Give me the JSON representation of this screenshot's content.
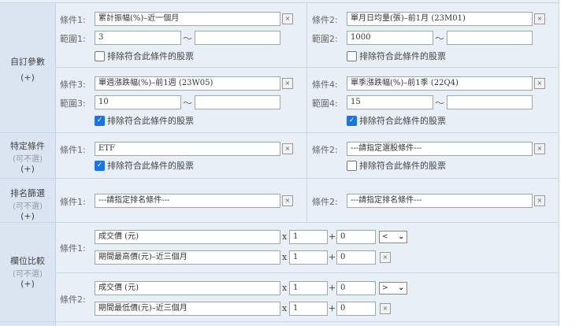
{
  "sections": {
    "custom": {
      "title": "自訂參數",
      "plus": "(+)"
    },
    "specific": {
      "title": "特定條件",
      "optional": "(可不選)",
      "plus": "(+)"
    },
    "rank": {
      "title": "排名篩選",
      "optional": "(可不選)",
      "plus": "(+)"
    },
    "compare": {
      "title": "欄位比較",
      "optional": "(可不選)",
      "plus": "(+)"
    }
  },
  "exclude_label": "排除符合此條件的股票",
  "remove": "×",
  "tilde": "～",
  "custom": [
    {
      "label": "條件1:",
      "value": "累計振幅(%)–近一個月",
      "range_label": "範圍1:",
      "min": "3",
      "max": "",
      "exclude": false
    },
    {
      "label": "條件2:",
      "value": "單月日均量(張)–前1月 (23M01)",
      "range_label": "範圍2:",
      "min": "1000",
      "max": "",
      "exclude": false
    },
    {
      "label": "條件3:",
      "value": "單週漲跌幅(%)–前1週 (23W05)",
      "range_label": "範圍3:",
      "min": "10",
      "max": "",
      "exclude": true
    },
    {
      "label": "條件4:",
      "value": "單季漲跌幅(%)–前1季 (22Q4)",
      "range_label": "範圍4:",
      "min": "15",
      "max": "",
      "exclude": true
    }
  ],
  "specific": [
    {
      "label": "條件1:",
      "value": "ETF",
      "exclude": true
    },
    {
      "label": "條件2:",
      "value": "---請指定選股條件---",
      "exclude": false
    }
  ],
  "rank": [
    {
      "label": "條件1:",
      "value": "---請指定排名條件---"
    },
    {
      "label": "條件2:",
      "value": "---請指定排名條件---"
    }
  ],
  "compare": [
    {
      "label": "條件1:",
      "operator": "<",
      "a": {
        "field": "成交價 (元)",
        "mult": "1",
        "add": "0"
      },
      "b": {
        "field": "期間最高價(元)–近三個月",
        "mult": "1",
        "add": "0"
      }
    },
    {
      "label": "條件2:",
      "operator": ">",
      "a": {
        "field": "成交價 (元)",
        "mult": "1",
        "add": "0"
      },
      "b": {
        "field": "期間最低價(元)–近三個月",
        "mult": "1",
        "add": "0"
      }
    }
  ],
  "x_sym": "x",
  "plus_sym": "+",
  "chevron": "⌄"
}
